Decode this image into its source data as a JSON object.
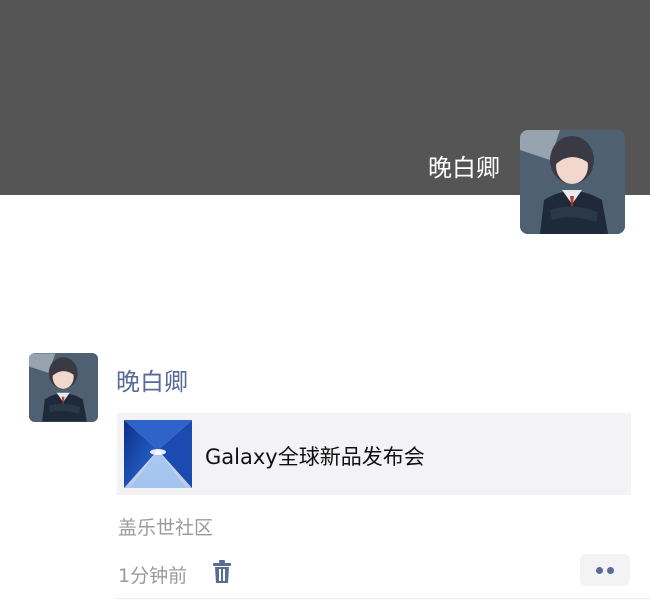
{
  "cover": {
    "user_name": "晚白卿",
    "background_color": "#555555"
  },
  "post": {
    "author": "晚白卿",
    "link": {
      "title": "Galaxy全球新品发布会",
      "thumbnail_icon": "samsung-galaxy-thumbnail"
    },
    "source": "盖乐世社区",
    "time": "1分钟前",
    "delete_icon": "trash-icon",
    "more_icon": "more-dots-icon"
  },
  "colors": {
    "name_blue": "#576b95",
    "meta_gray": "#9a9a9a",
    "card_bg": "#f3f3f5"
  }
}
